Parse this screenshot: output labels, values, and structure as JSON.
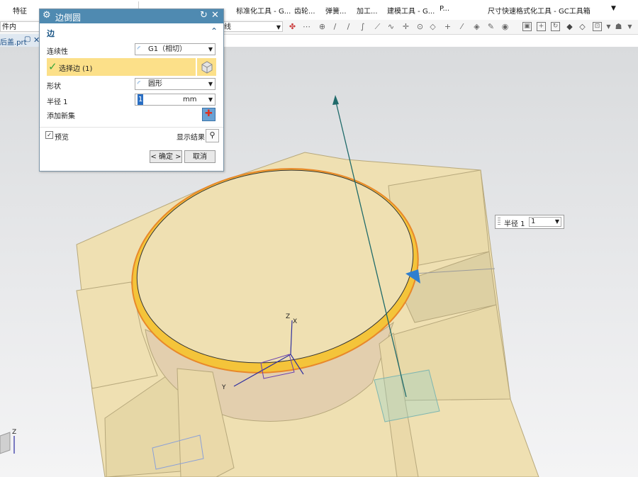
{
  "ribbon": {
    "tabs": [
      "特征",
      "标准化工具 - G...",
      "齿轮...",
      "弹簧...",
      "加工...",
      "建模工具 - G...",
      "P...",
      "尺寸快速格式化工具 - GC工具箱"
    ]
  },
  "toolbar": {
    "left_field": "件内",
    "middle_field": "线"
  },
  "file_tab": {
    "name": "后盖.prt"
  },
  "dialog": {
    "title": "边倒圆",
    "section": "边",
    "continuity_label": "连续性",
    "continuity_value": "G1（相切）",
    "select_edge_label": "选择边 (1)",
    "shape_label": "形状",
    "shape_value": "圆形",
    "radius_label": "半径 1",
    "radius_value": "1",
    "radius_unit": "mm",
    "add_new_set_label": "添加新集",
    "preview_label": "预览",
    "show_result_label": "显示结果",
    "ok_label": "< 确定 >",
    "cancel_label": "取消"
  },
  "callout": {
    "label": "半径 1",
    "value": "1"
  },
  "axes": {
    "z": "Z",
    "y": "Y",
    "x": "X"
  },
  "colors": {
    "title_bar": "#4f8ab1",
    "selection_highlight": "#fce089",
    "part_body": "#efe0b2",
    "rim": "#f7d430"
  }
}
